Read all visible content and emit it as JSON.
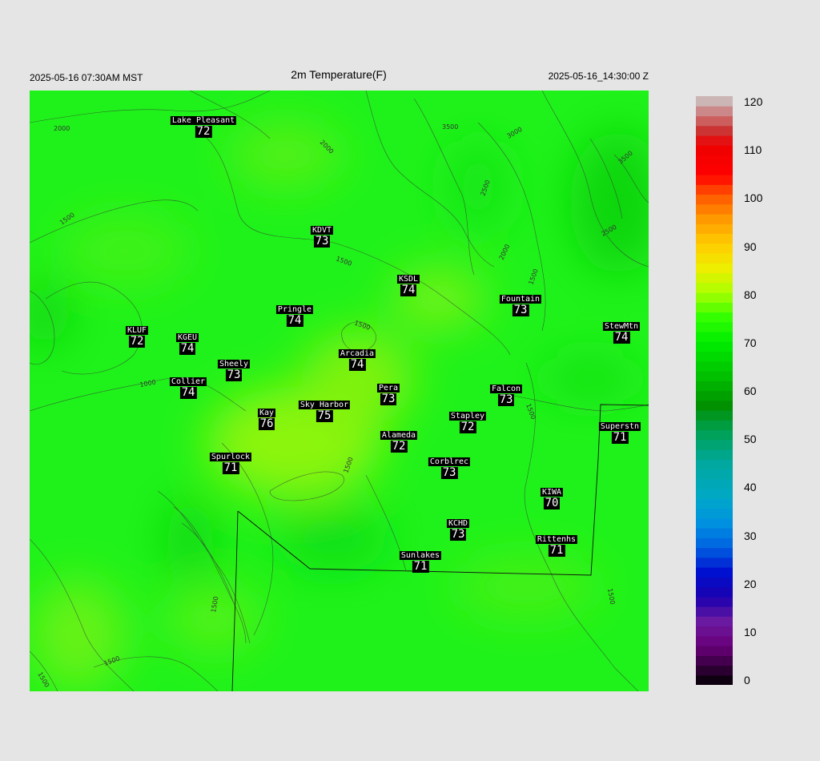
{
  "header": {
    "title": "2m Temperature(F)",
    "valid_local": "2025-05-16 07:30AM MST",
    "valid_utc": "2025-05-16_14:30:00 Z"
  },
  "stations": [
    {
      "name": "Lake Pleasant",
      "value": "72"
    },
    {
      "name": "KDVT",
      "value": "73"
    },
    {
      "name": "KSDL",
      "value": "74"
    },
    {
      "name": "Fountain",
      "value": "73"
    },
    {
      "name": "StewMtn",
      "value": "74"
    },
    {
      "name": "Pringle",
      "value": "74"
    },
    {
      "name": "KLUF",
      "value": "72"
    },
    {
      "name": "KGEU",
      "value": "74"
    },
    {
      "name": "Arcadia",
      "value": "74"
    },
    {
      "name": "Sheely",
      "value": "73"
    },
    {
      "name": "Collier",
      "value": "74"
    },
    {
      "name": "Pera",
      "value": "73"
    },
    {
      "name": "Falcon",
      "value": "73"
    },
    {
      "name": "Kay",
      "value": "76"
    },
    {
      "name": "Sky Harbor",
      "value": "75"
    },
    {
      "name": "Stapley",
      "value": "72"
    },
    {
      "name": "Superstn",
      "value": "71"
    },
    {
      "name": "Alameda",
      "value": "72"
    },
    {
      "name": "Spurlock",
      "value": "71"
    },
    {
      "name": "Corblrec",
      "value": "73"
    },
    {
      "name": "KIWA",
      "value": "70"
    },
    {
      "name": "KCHD",
      "value": "73"
    },
    {
      "name": "Rittenhs",
      "value": "71"
    },
    {
      "name": "Sunlakes",
      "value": "71"
    }
  ],
  "contour_labels": [
    "2000",
    "2000",
    "3500",
    "3000",
    "3500",
    "1500",
    "2500",
    "2500",
    "1500",
    "2000",
    "1500",
    "1500",
    "1000",
    "1500",
    "1500",
    "1500",
    "1500",
    "1500",
    "1500"
  ],
  "colorbar": {
    "ticks": [
      "120",
      "110",
      "100",
      "90",
      "80",
      "70",
      "60",
      "50",
      "40",
      "30",
      "20",
      "10",
      "0"
    ],
    "min": 0,
    "max": 120
  }
}
